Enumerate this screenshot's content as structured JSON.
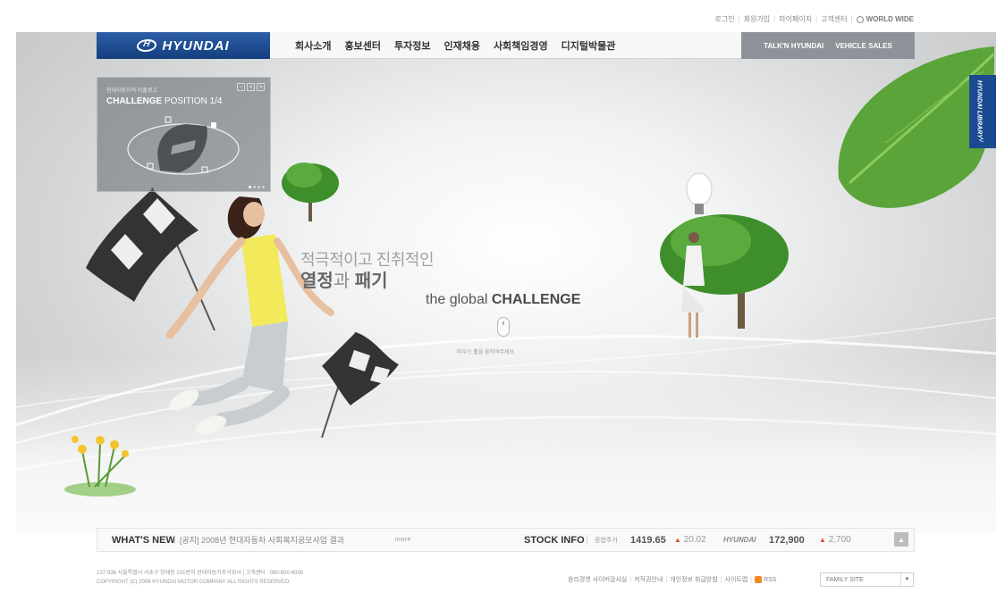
{
  "util_links": [
    "로그인",
    "회원가입",
    "마이페이지",
    "고객센터"
  ],
  "world_wide": "WORLD WIDE",
  "brand": {
    "name": "HYUNDAI"
  },
  "nav": {
    "items": [
      "회사소개",
      "홍보센터",
      "투자정보",
      "인재채용",
      "사회책임경영",
      "디지털박물관"
    ],
    "right": [
      "TALK'N HYUNDAI",
      "VEHICLE SALES"
    ]
  },
  "panel": {
    "small_text": "현대자동차의 미출광고",
    "title_bold": "CHALLENGE",
    "title_rest": " POSITION  1/4",
    "controls": [
      "−",
      "<",
      ">"
    ]
  },
  "library": {
    "label": "HYUNDAI LIBRARY",
    "arrow": "<"
  },
  "hero": {
    "line1": "적극적이고 진취적인",
    "line2_a": "열정",
    "line2_b": "과",
    "line2_c": " 패기",
    "global_prefix": "the global ",
    "global_bold": "CHALLENGE",
    "hint": "마우스 휠을 움직여주세요."
  },
  "whats_new": {
    "label": "WHAT'S NEW",
    "text": "[공지] 2008년 현대자동차 사회복지공모사업 결과",
    "more": "more"
  },
  "stock": {
    "label": "STOCK INFO",
    "index_label": "종합주가",
    "index_value": "1419.65",
    "index_change": "20.02",
    "company_label": "HYUNDAI",
    "company_value": "172,900",
    "company_change": "2,700"
  },
  "footer": {
    "address": "137-938 서울특별시 서초구 양재동 231번지 현대자동차주식회사 | 고객센터 : 080-600-6000",
    "copyright": "COPYRIGHT (C) 2008 HYUNDAI MOTOR COMPANY ALL RIGHTS RESERVED.",
    "links": [
      "윤리경영 사이버감사실",
      "저작권안내",
      "개인정보 취급방침",
      "사이트맵"
    ],
    "rss": "RSS",
    "family_site": "FAMILY SITE"
  },
  "colors": {
    "brand_blue": "#1f4d93",
    "stock_up": "#e04d2a"
  }
}
